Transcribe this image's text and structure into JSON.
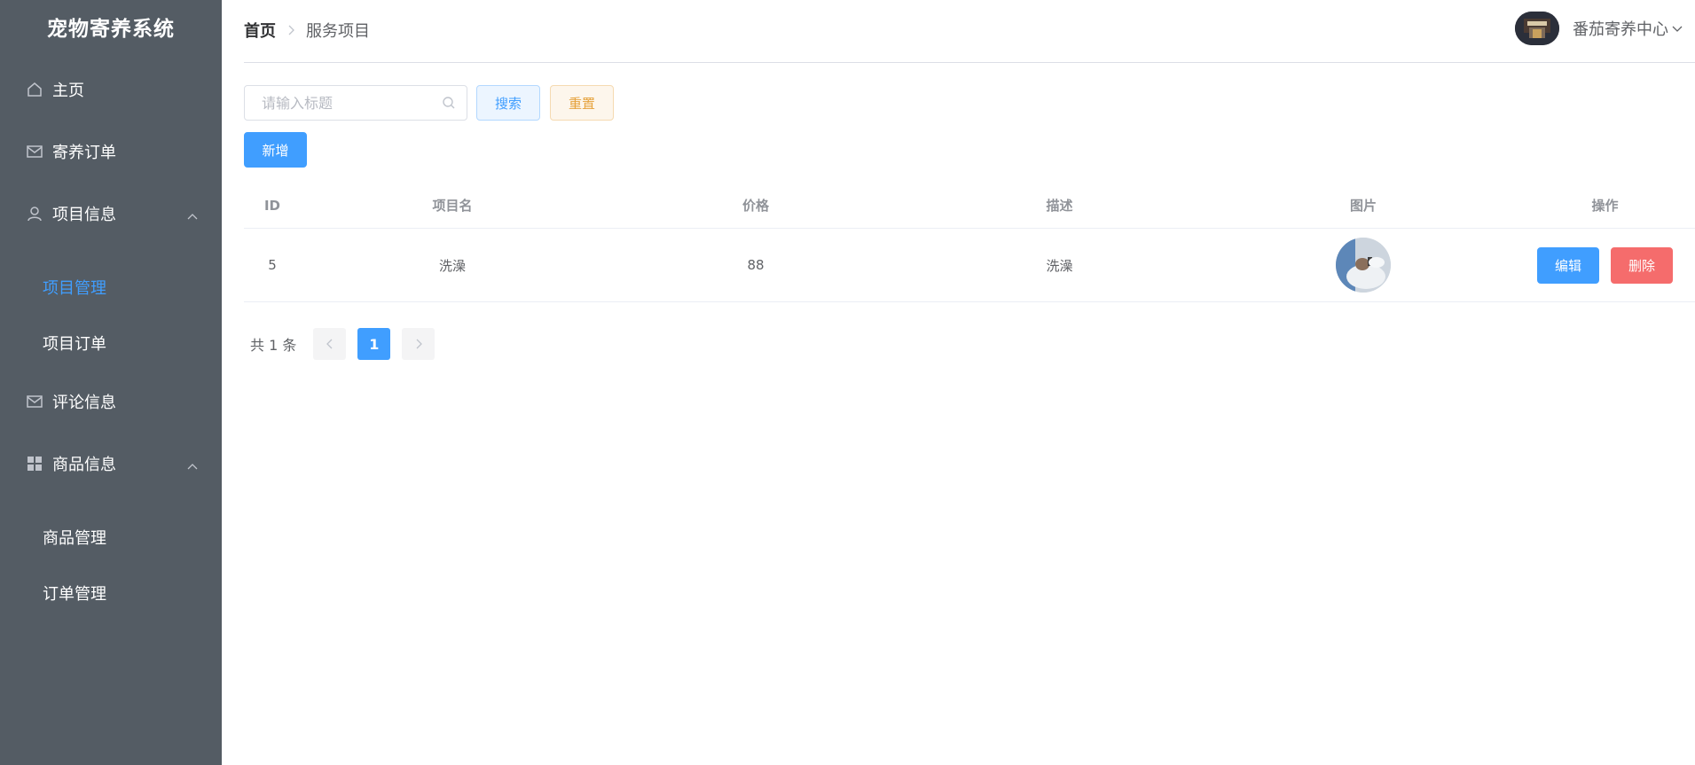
{
  "app": {
    "title": "宠物寄养系统"
  },
  "sidebar": {
    "items": [
      {
        "label": "主页",
        "icon": "home-icon"
      },
      {
        "label": "寄养订单",
        "icon": "message-icon"
      },
      {
        "label": "项目信息",
        "icon": "user-icon",
        "expanded": true,
        "children": [
          {
            "label": "项目管理",
            "active": true
          },
          {
            "label": "项目订单"
          }
        ]
      },
      {
        "label": "评论信息",
        "icon": "message-icon"
      },
      {
        "label": "商品信息",
        "icon": "grid-icon",
        "expanded": true,
        "children": [
          {
            "label": "商品管理"
          },
          {
            "label": "订单管理"
          }
        ]
      }
    ]
  },
  "header": {
    "breadcrumb": {
      "home": "首页",
      "current": "服务项目"
    },
    "user": {
      "name": "番茄寄养中心"
    }
  },
  "toolbar": {
    "search_placeholder": "请输入标题",
    "search_value": "",
    "search_label": "搜索",
    "reset_label": "重置",
    "add_label": "新增"
  },
  "table": {
    "columns": [
      "ID",
      "项目名",
      "价格",
      "描述",
      "图片",
      "操作"
    ],
    "rows": [
      {
        "id": "5",
        "name": "洗澡",
        "price": "88",
        "description": "洗澡",
        "edit_label": "编辑",
        "delete_label": "删除"
      }
    ]
  },
  "pagination": {
    "total_text": "共 1 条",
    "current_page": "1"
  },
  "colors": {
    "sidebar_bg": "#545c64",
    "active": "#409eff",
    "primary": "#409eff",
    "warning": "#e6a23c",
    "danger": "#f56c6c"
  }
}
